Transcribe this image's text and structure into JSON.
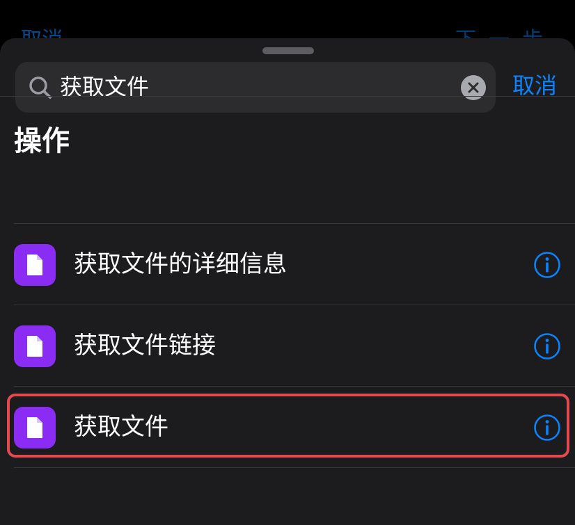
{
  "background": {
    "cancel_label": "取消",
    "next_label": "下一步"
  },
  "search": {
    "value": "获取文件",
    "cancel_label": "取消"
  },
  "section": {
    "title": "操作"
  },
  "actions": [
    {
      "label": "获取文件的详细信息",
      "icon": "document-icon"
    },
    {
      "label": "获取文件链接",
      "icon": "document-icon"
    },
    {
      "label": "获取文件",
      "icon": "document-icon",
      "highlighted": true
    }
  ],
  "colors": {
    "accent": "#0a84ff",
    "icon_bg": "#8b2cf5",
    "highlight": "#e34a4f"
  }
}
